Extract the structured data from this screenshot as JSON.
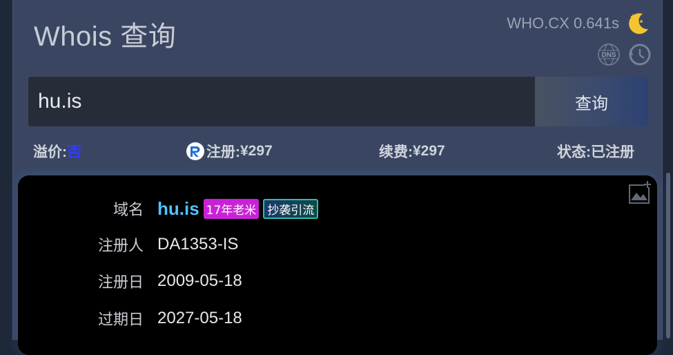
{
  "header": {
    "title": "Whois 查询",
    "site_timing": "WHO.CX 0.641s"
  },
  "icons": {
    "theme": "moon-icon",
    "dns": "dns-icon",
    "history": "history-icon",
    "screenshot": "image-icon",
    "registrar": "r-icon"
  },
  "search": {
    "value": "hu.is",
    "button_label": "查询"
  },
  "summary": {
    "premium_label": "溢价:",
    "premium_value": "否",
    "register_label": "注册:",
    "register_value": "¥297",
    "renew_label": "续费:",
    "renew_value": "¥297",
    "status_label": "状态:",
    "status_value": "已注册"
  },
  "result": {
    "rows": [
      {
        "label": "域名",
        "value": "hu.is"
      },
      {
        "label": "注册人",
        "value": "DA1353-IS"
      },
      {
        "label": "注册日",
        "value": "2009-05-18"
      },
      {
        "label": "过期日",
        "value": "2027-05-18"
      }
    ],
    "tags": {
      "age": "17年老米",
      "copy": "抄袭引流"
    }
  },
  "colors": {
    "panel_bg": "#3a4661",
    "input_bg": "#272d38",
    "card_bg": "#000000",
    "domain_link": "#4fc3ff",
    "premium_no": "#2f3cff",
    "tag_age_bg": "#c922d6",
    "tag_copy_border": "#2bbfae"
  }
}
